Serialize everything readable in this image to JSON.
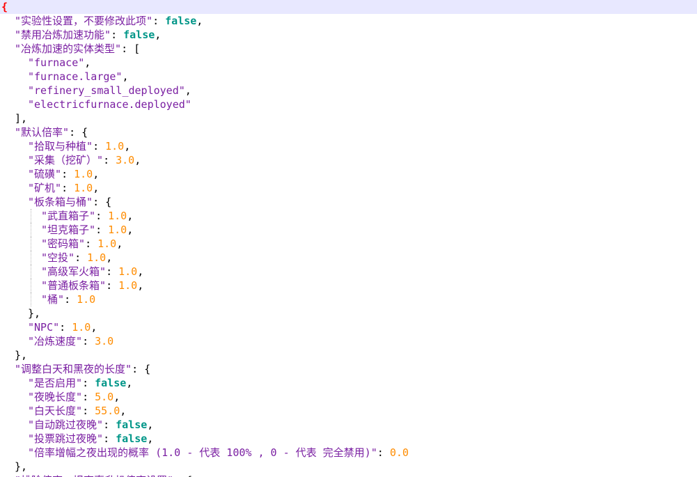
{
  "editor": {
    "language": "json",
    "colors": {
      "key": "#7a1fa2",
      "string": "#7a1fa2",
      "number": "#ff8c00",
      "boolean": "#009688",
      "punctuation": "#000000",
      "matched_brace": "#ff0000",
      "current_line": "#e8e8ff"
    },
    "lines": [
      {
        "indent": 0,
        "tokens": [
          {
            "t": "brace-hl",
            "v": "{"
          }
        ]
      },
      {
        "indent": 1,
        "tokens": [
          {
            "t": "key",
            "v": "\"实验性设置，不要修改此项\""
          },
          {
            "t": "punc",
            "v": ": "
          },
          {
            "t": "bool",
            "v": "false"
          },
          {
            "t": "punc",
            "v": ","
          }
        ]
      },
      {
        "indent": 1,
        "tokens": [
          {
            "t": "key",
            "v": "\"禁用冶炼加速功能\""
          },
          {
            "t": "punc",
            "v": ": "
          },
          {
            "t": "bool",
            "v": "false"
          },
          {
            "t": "punc",
            "v": ","
          }
        ]
      },
      {
        "indent": 1,
        "tokens": [
          {
            "t": "key",
            "v": "\"冶炼加速的实体类型\""
          },
          {
            "t": "punc",
            "v": ": ["
          }
        ]
      },
      {
        "indent": 2,
        "tokens": [
          {
            "t": "str",
            "v": "\"furnace\""
          },
          {
            "t": "punc",
            "v": ","
          }
        ]
      },
      {
        "indent": 2,
        "tokens": [
          {
            "t": "str",
            "v": "\"furnace.large\""
          },
          {
            "t": "punc",
            "v": ","
          }
        ]
      },
      {
        "indent": 2,
        "tokens": [
          {
            "t": "str",
            "v": "\"refinery_small_deployed\""
          },
          {
            "t": "punc",
            "v": ","
          }
        ]
      },
      {
        "indent": 2,
        "tokens": [
          {
            "t": "str",
            "v": "\"electricfurnace.deployed\""
          }
        ]
      },
      {
        "indent": 1,
        "tokens": [
          {
            "t": "punc",
            "v": "],"
          }
        ]
      },
      {
        "indent": 1,
        "tokens": [
          {
            "t": "key",
            "v": "\"默认倍率\""
          },
          {
            "t": "punc",
            "v": ": {"
          }
        ]
      },
      {
        "indent": 2,
        "tokens": [
          {
            "t": "key",
            "v": "\"拾取与种植\""
          },
          {
            "t": "punc",
            "v": ": "
          },
          {
            "t": "num",
            "v": "1.0"
          },
          {
            "t": "punc",
            "v": ","
          }
        ]
      },
      {
        "indent": 2,
        "tokens": [
          {
            "t": "key",
            "v": "\"采集（挖矿）\""
          },
          {
            "t": "punc",
            "v": ": "
          },
          {
            "t": "num",
            "v": "3.0"
          },
          {
            "t": "punc",
            "v": ","
          }
        ]
      },
      {
        "indent": 2,
        "tokens": [
          {
            "t": "key",
            "v": "\"硫磺\""
          },
          {
            "t": "punc",
            "v": ": "
          },
          {
            "t": "num",
            "v": "1.0"
          },
          {
            "t": "punc",
            "v": ","
          }
        ]
      },
      {
        "indent": 2,
        "tokens": [
          {
            "t": "key",
            "v": "\"矿机\""
          },
          {
            "t": "punc",
            "v": ": "
          },
          {
            "t": "num",
            "v": "1.0"
          },
          {
            "t": "punc",
            "v": ","
          }
        ]
      },
      {
        "indent": 2,
        "tokens": [
          {
            "t": "key",
            "v": "\"板条箱与桶\""
          },
          {
            "t": "punc",
            "v": ": {"
          }
        ]
      },
      {
        "indent": 3,
        "tokens": [
          {
            "t": "key",
            "v": "\"武直箱子\""
          },
          {
            "t": "punc",
            "v": ": "
          },
          {
            "t": "num",
            "v": "1.0"
          },
          {
            "t": "punc",
            "v": ","
          }
        ]
      },
      {
        "indent": 3,
        "tokens": [
          {
            "t": "key",
            "v": "\"坦克箱子\""
          },
          {
            "t": "punc",
            "v": ": "
          },
          {
            "t": "num",
            "v": "1.0"
          },
          {
            "t": "punc",
            "v": ","
          }
        ]
      },
      {
        "indent": 3,
        "tokens": [
          {
            "t": "key",
            "v": "\"密码箱\""
          },
          {
            "t": "punc",
            "v": ": "
          },
          {
            "t": "num",
            "v": "1.0"
          },
          {
            "t": "punc",
            "v": ","
          }
        ]
      },
      {
        "indent": 3,
        "tokens": [
          {
            "t": "key",
            "v": "\"空投\""
          },
          {
            "t": "punc",
            "v": ": "
          },
          {
            "t": "num",
            "v": "1.0"
          },
          {
            "t": "punc",
            "v": ","
          }
        ]
      },
      {
        "indent": 3,
        "tokens": [
          {
            "t": "key",
            "v": "\"高级军火箱\""
          },
          {
            "t": "punc",
            "v": ": "
          },
          {
            "t": "num",
            "v": "1.0"
          },
          {
            "t": "punc",
            "v": ","
          }
        ]
      },
      {
        "indent": 3,
        "tokens": [
          {
            "t": "key",
            "v": "\"普通板条箱\""
          },
          {
            "t": "punc",
            "v": ": "
          },
          {
            "t": "num",
            "v": "1.0"
          },
          {
            "t": "punc",
            "v": ","
          }
        ]
      },
      {
        "indent": 3,
        "tokens": [
          {
            "t": "key",
            "v": "\"桶\""
          },
          {
            "t": "punc",
            "v": ": "
          },
          {
            "t": "num",
            "v": "1.0"
          }
        ]
      },
      {
        "indent": 2,
        "tokens": [
          {
            "t": "punc",
            "v": "},"
          }
        ]
      },
      {
        "indent": 2,
        "tokens": [
          {
            "t": "key",
            "v": "\"NPC\""
          },
          {
            "t": "punc",
            "v": ": "
          },
          {
            "t": "num",
            "v": "1.0"
          },
          {
            "t": "punc",
            "v": ","
          }
        ]
      },
      {
        "indent": 2,
        "tokens": [
          {
            "t": "key",
            "v": "\"冶炼速度\""
          },
          {
            "t": "punc",
            "v": ": "
          },
          {
            "t": "num",
            "v": "3.0"
          }
        ]
      },
      {
        "indent": 1,
        "tokens": [
          {
            "t": "punc",
            "v": "},"
          }
        ]
      },
      {
        "indent": 1,
        "tokens": [
          {
            "t": "key",
            "v": "\"调整白天和黑夜的长度\""
          },
          {
            "t": "punc",
            "v": ": {"
          }
        ]
      },
      {
        "indent": 2,
        "tokens": [
          {
            "t": "key",
            "v": "\"是否启用\""
          },
          {
            "t": "punc",
            "v": ": "
          },
          {
            "t": "bool",
            "v": "false"
          },
          {
            "t": "punc",
            "v": ","
          }
        ]
      },
      {
        "indent": 2,
        "tokens": [
          {
            "t": "key",
            "v": "\"夜晚长度\""
          },
          {
            "t": "punc",
            "v": ": "
          },
          {
            "t": "num",
            "v": "5.0"
          },
          {
            "t": "punc",
            "v": ","
          }
        ]
      },
      {
        "indent": 2,
        "tokens": [
          {
            "t": "key",
            "v": "\"白天长度\""
          },
          {
            "t": "punc",
            "v": ": "
          },
          {
            "t": "num",
            "v": "55.0"
          },
          {
            "t": "punc",
            "v": ","
          }
        ]
      },
      {
        "indent": 2,
        "tokens": [
          {
            "t": "key",
            "v": "\"自动跳过夜晚\""
          },
          {
            "t": "punc",
            "v": ": "
          },
          {
            "t": "bool",
            "v": "false"
          },
          {
            "t": "punc",
            "v": ","
          }
        ]
      },
      {
        "indent": 2,
        "tokens": [
          {
            "t": "key",
            "v": "\"投票跳过夜晚\""
          },
          {
            "t": "punc",
            "v": ": "
          },
          {
            "t": "bool",
            "v": "false"
          },
          {
            "t": "punc",
            "v": ","
          }
        ]
      },
      {
        "indent": 2,
        "tokens": [
          {
            "t": "key",
            "v": "\"倍率增幅之夜出现的概率 (1.0 - 代表 100% , 0 - 代表 完全禁用)\""
          },
          {
            "t": "punc",
            "v": ": "
          },
          {
            "t": "num",
            "v": "0.0"
          }
        ]
      },
      {
        "indent": 1,
        "tokens": [
          {
            "t": "punc",
            "v": "},"
          }
        ]
      },
      {
        "indent": 1,
        "tokens": [
          {
            "t": "key",
            "v": "\"排除倍率，坦克直升机倍率设置\""
          },
          {
            "t": "punc",
            "v": ": {"
          }
        ]
      }
    ]
  }
}
